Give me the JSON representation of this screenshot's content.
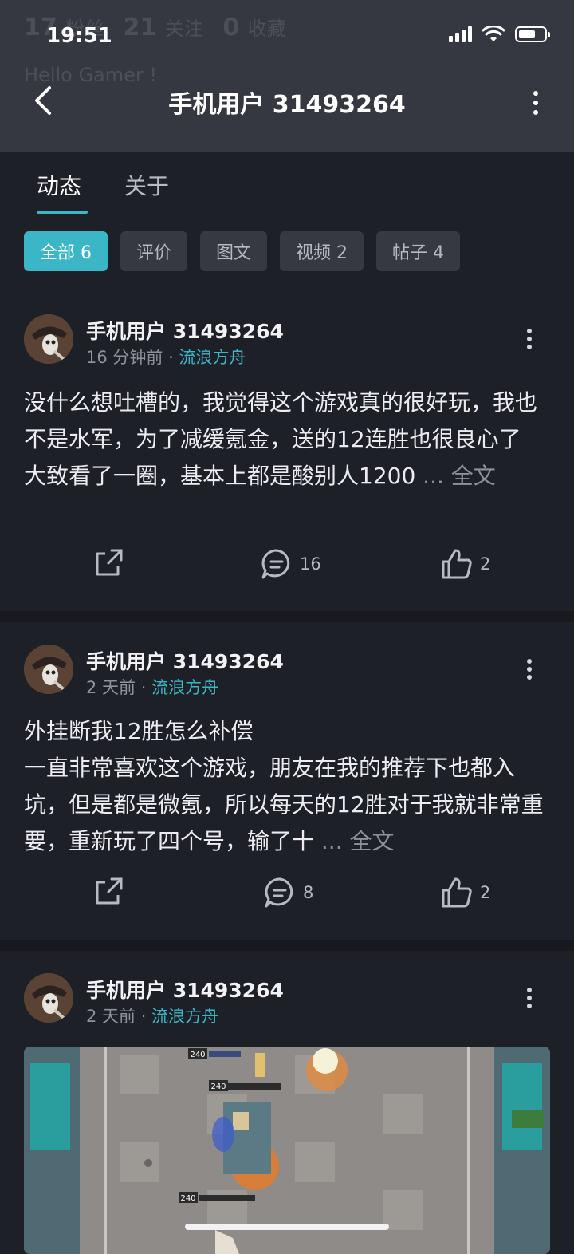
{
  "status_bar": {
    "time": "19:51"
  },
  "profile_ghost": {
    "fans_count": "17",
    "fans_label": "粉丝",
    "follow_count": "21",
    "follow_label": "关注",
    "fav_count": "0",
    "fav_label": "收藏",
    "bio": "Hello Gamer !"
  },
  "nav": {
    "title": "手机用户 31493264"
  },
  "tabs": [
    {
      "label": "动态",
      "active": true
    },
    {
      "label": "关于",
      "active": false
    }
  ],
  "filters": [
    {
      "label": "全部 6",
      "active": true
    },
    {
      "label": "评价",
      "active": false
    },
    {
      "label": "图文",
      "active": false
    },
    {
      "label": "视频 2",
      "active": false
    },
    {
      "label": "帖子 4",
      "active": false
    }
  ],
  "posts": [
    {
      "author": "手机用户 31493264",
      "time": "16 分钟前",
      "game": "流浪方舟",
      "lines": [
        "没什么想吐槽的，我觉得这个游戏真的很好玩，我也不是水军，为了减缓氪金，送的12连胜也很良心了",
        "大致看了一圈，基本上都是酸别人1200 "
      ],
      "more": "... 全文",
      "comments": "16",
      "likes": "2"
    },
    {
      "author": "手机用户 31493264",
      "time": "2 天前",
      "game": "流浪方舟",
      "lines": [
        "外挂断我12胜怎么补偿",
        "一直非常喜欢这个游戏，朋友在我的推荐下也都入坑，但是都是微氪，所以每天的12胜对于我就非常重要，重新玩了四个号，输了十 "
      ],
      "more": "... 全文",
      "comments": "8",
      "likes": "2"
    },
    {
      "author": "手机用户 31493264",
      "time": "2 天前",
      "game": "流浪方舟",
      "image_labels": [
        "240",
        "240",
        "240"
      ]
    }
  ],
  "colors": {
    "accent": "#3bb6c6",
    "background": "#1e2028",
    "header": "#353840"
  }
}
